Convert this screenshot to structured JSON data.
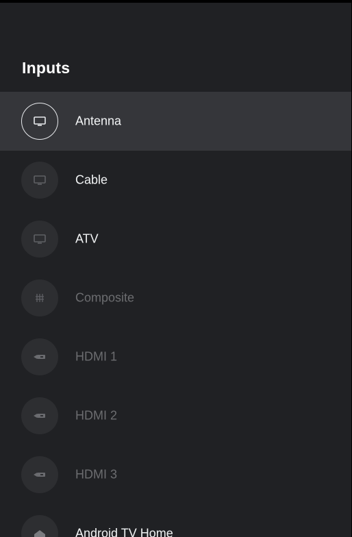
{
  "header": {
    "title": "Inputs"
  },
  "inputs": [
    {
      "label": "Antenna",
      "icon": "tv-icon",
      "state": "focused"
    },
    {
      "label": "Cable",
      "icon": "tv-icon",
      "state": "active"
    },
    {
      "label": "ATV",
      "icon": "tv-icon",
      "state": "active"
    },
    {
      "label": "Composite",
      "icon": "composite-icon",
      "state": "disabled"
    },
    {
      "label": "HDMI 1",
      "icon": "hdmi-icon",
      "state": "disabled"
    },
    {
      "label": "HDMI 2",
      "icon": "hdmi-icon",
      "state": "disabled"
    },
    {
      "label": "HDMI 3",
      "icon": "hdmi-icon",
      "state": "disabled"
    },
    {
      "label": "Android TV Home",
      "icon": "home-icon",
      "state": "active"
    }
  ],
  "colors": {
    "panel_background": "#202124",
    "focused_row": "#35363a",
    "text_active": "#f1f3f4",
    "text_disabled": "#6c6d70"
  }
}
